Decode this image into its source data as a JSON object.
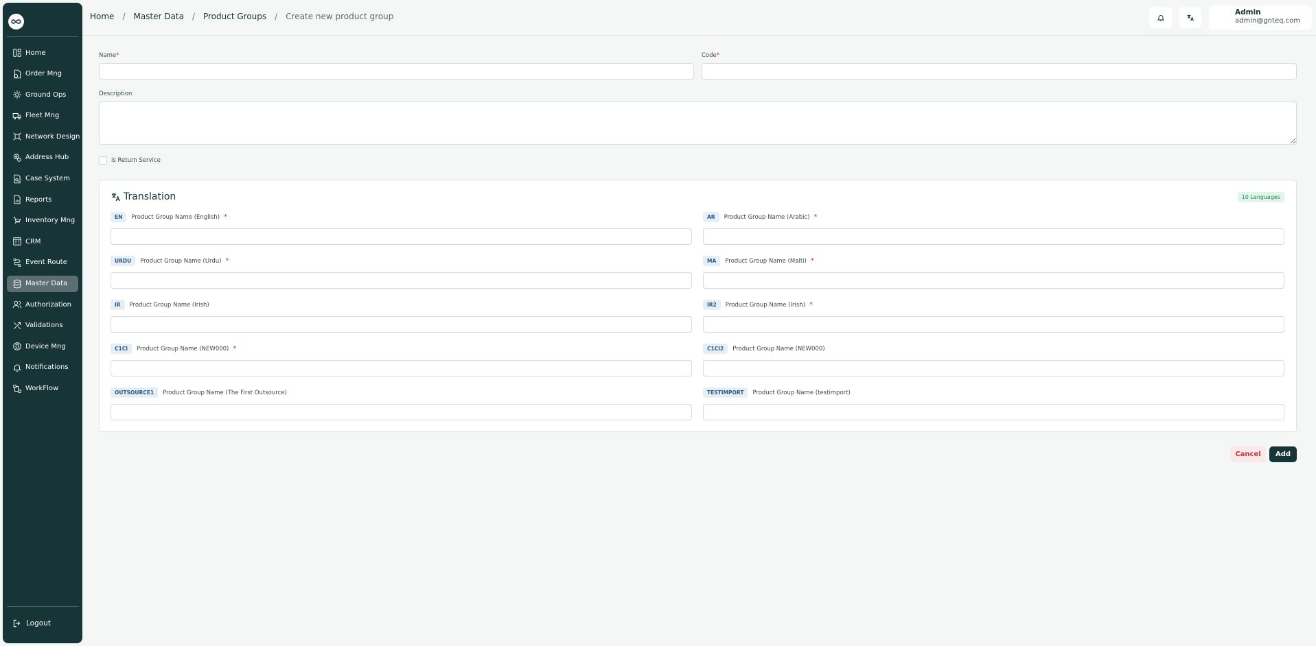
{
  "sidebar": {
    "items": [
      {
        "label": "Home",
        "icon": "home-icon"
      },
      {
        "label": "Order Mng",
        "icon": "order-icon"
      },
      {
        "label": "Ground Ops",
        "icon": "ground-ops-icon"
      },
      {
        "label": "Fleet Mng",
        "icon": "truck-icon"
      },
      {
        "label": "Network Design",
        "icon": "network-icon"
      },
      {
        "label": "Address Hub",
        "icon": "address-icon"
      },
      {
        "label": "Case System",
        "icon": "case-icon"
      },
      {
        "label": "Reports",
        "icon": "reports-icon"
      },
      {
        "label": "Inventory Mng",
        "icon": "inventory-icon"
      },
      {
        "label": "CRM",
        "icon": "crm-icon"
      },
      {
        "label": "Event Route",
        "icon": "route-icon"
      },
      {
        "label": "Master Data",
        "icon": "database-icon"
      },
      {
        "label": "Authorization",
        "icon": "users-icon"
      },
      {
        "label": "Validations",
        "icon": "tools-icon"
      },
      {
        "label": "Device Mng",
        "icon": "device-icon"
      },
      {
        "label": "Notifications",
        "icon": "bell-icon"
      },
      {
        "label": "WorkFlow",
        "icon": "workflow-icon"
      }
    ],
    "active_item": "Master Data",
    "logout_label": "Logout"
  },
  "breadcrumb": {
    "home": "Home",
    "master_data": "Master Data",
    "product_groups": "Product Groups",
    "current": "Create new product group"
  },
  "user": {
    "name": "Admin",
    "email": "admin@gnteq.com"
  },
  "form": {
    "name_label": "Name",
    "code_label": "Code",
    "description_label": "Description",
    "required_mark": "*",
    "return_service_label": "is Return Service"
  },
  "translation": {
    "title": "Translation",
    "languages_badge": "10 Languages",
    "fields": [
      {
        "code": "EN",
        "label": "Product Group Name (English)",
        "required": true
      },
      {
        "code": "AR",
        "label": "Product Group Name (Arabic)",
        "required": true
      },
      {
        "code": "URDU",
        "label": "Product Group Name (Urdu)",
        "required": true
      },
      {
        "code": "MA",
        "label": "Product Group Name (Malti)",
        "required": true
      },
      {
        "code": "IR",
        "label": "Product Group Name (Irish)",
        "required": false
      },
      {
        "code": "IR2",
        "label": "Product Group Name (Irish)",
        "required": true
      },
      {
        "code": "C1CI",
        "label": "Product Group Name (NEW000)",
        "required": true
      },
      {
        "code": "C1CI2",
        "label": "Product Group Name (NEW000)",
        "required": false
      },
      {
        "code": "OUTSOURCE1",
        "label": "Product Group Name (The First Outsource)",
        "required": false
      },
      {
        "code": "TESTIMPORT",
        "label": "Product Group Name (testimport)",
        "required": false
      }
    ]
  },
  "actions": {
    "cancel_label": "Cancel",
    "add_label": "Add"
  },
  "colors": {
    "sidebar_bg": "#173436",
    "sidebar_active": "#5b6e70",
    "primary": "#173436",
    "required": "#d9302c",
    "badge_green_bg": "#e2f5ea",
    "badge_green_text": "#1c8a4c",
    "code_bg": "#e6eef6",
    "code_text": "#2a5a86",
    "cancel_text": "#c9313f"
  }
}
